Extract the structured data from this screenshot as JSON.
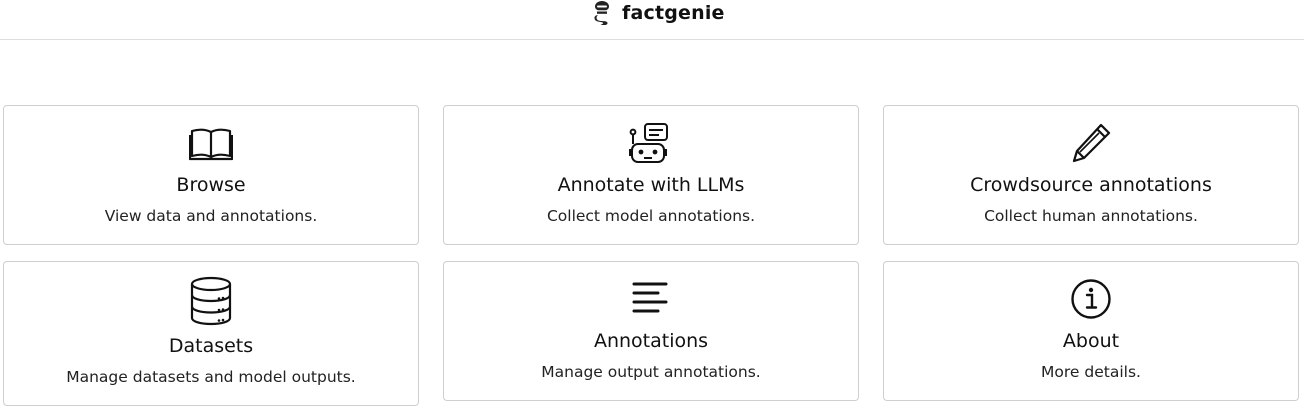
{
  "header": {
    "brand": "factgenie"
  },
  "cards": [
    {
      "title": "Browse",
      "description": "View data and annotations.",
      "icon": "book-open-icon"
    },
    {
      "title": "Annotate with LLMs",
      "description": "Collect model annotations.",
      "icon": "robot-chat-icon"
    },
    {
      "title": "Crowdsource annotations",
      "description": "Collect human annotations.",
      "icon": "pencil-icon"
    },
    {
      "title": "Datasets",
      "description": "Manage datasets and model outputs.",
      "icon": "database-icon"
    },
    {
      "title": "Annotations",
      "description": "Manage output annotations.",
      "icon": "text-lines-icon"
    },
    {
      "title": "About",
      "description": "More details.",
      "icon": "info-circle-icon"
    }
  ]
}
